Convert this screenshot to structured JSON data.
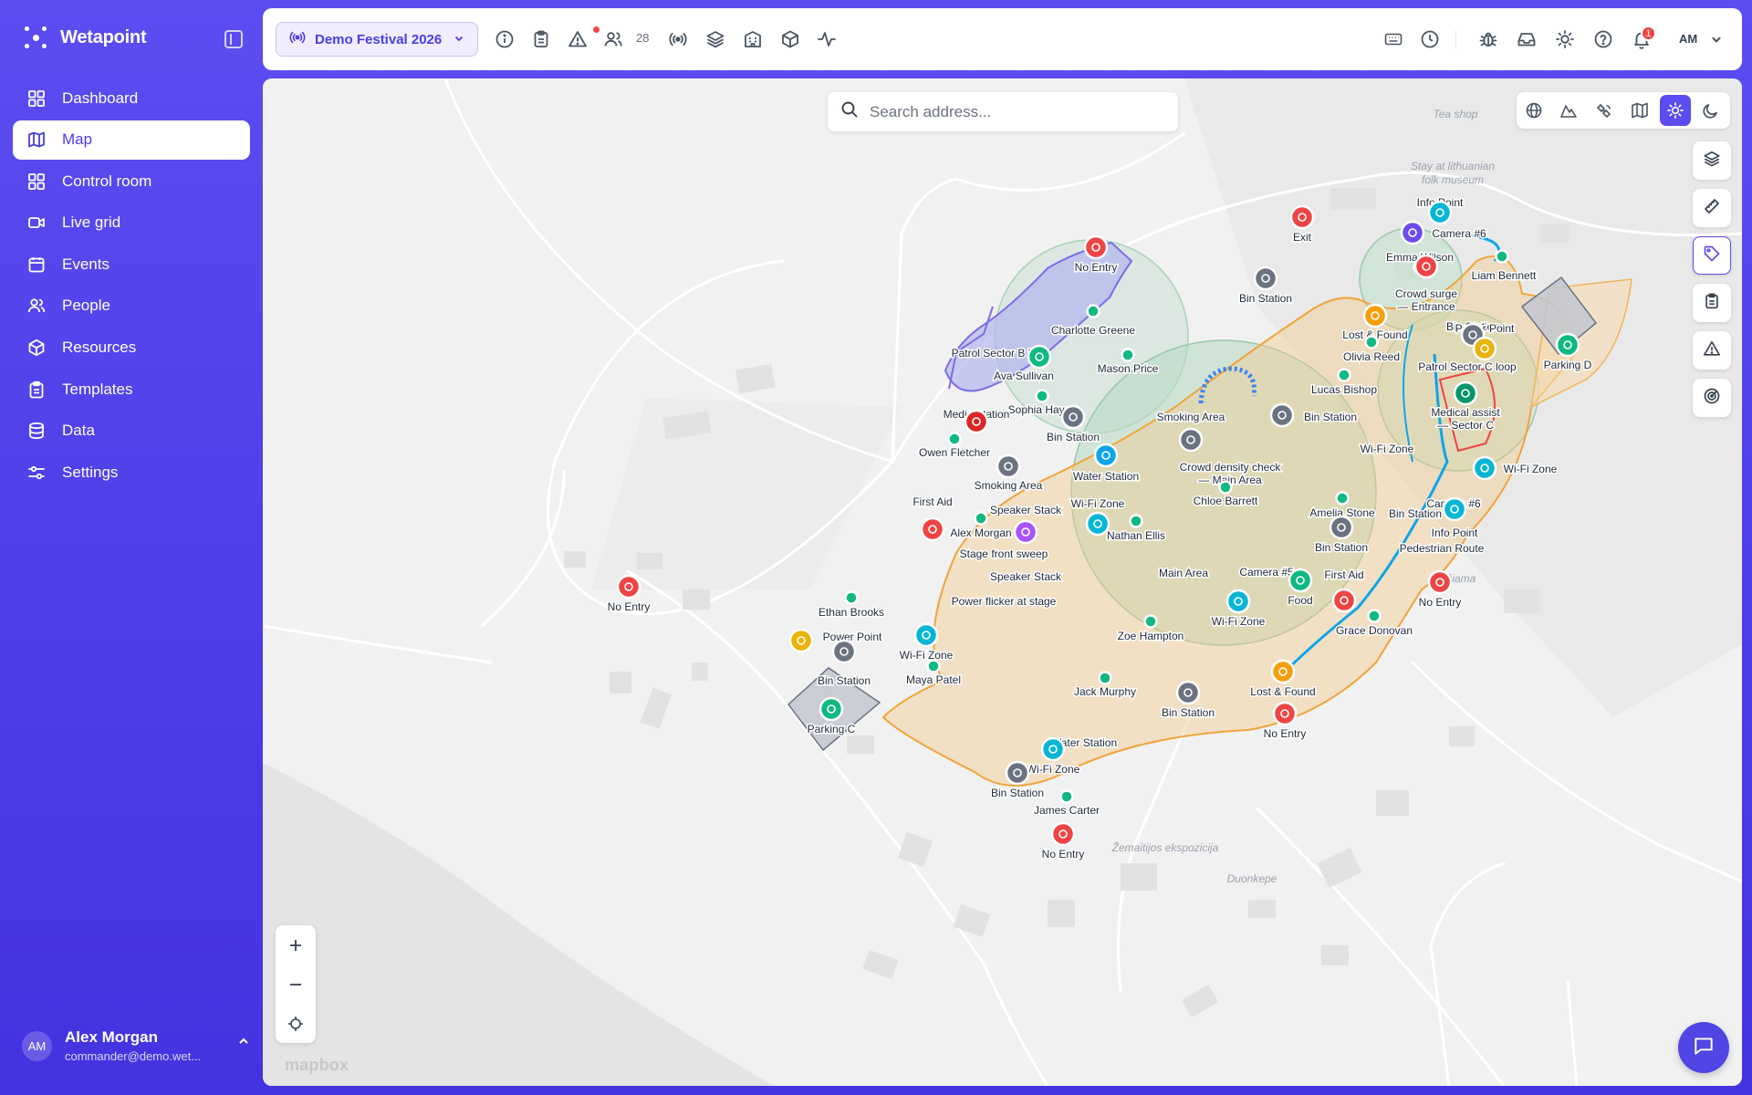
{
  "app": {
    "name": "Wetapoint"
  },
  "sidebar": {
    "items": [
      {
        "label": "Dashboard",
        "icon": "dashboard-icon"
      },
      {
        "label": "Map",
        "icon": "map-icon",
        "active": true
      },
      {
        "label": "Control room",
        "icon": "control-room-icon"
      },
      {
        "label": "Live grid",
        "icon": "video-icon"
      },
      {
        "label": "Events",
        "icon": "calendar-icon"
      },
      {
        "label": "People",
        "icon": "people-icon"
      },
      {
        "label": "Resources",
        "icon": "box-icon"
      },
      {
        "label": "Templates",
        "icon": "clipboard-icon"
      },
      {
        "label": "Data",
        "icon": "database-icon"
      },
      {
        "label": "Settings",
        "icon": "settings-icon"
      }
    ]
  },
  "user": {
    "initials": "AM",
    "name": "Alex Morgan",
    "email": "commander@demo.wet..."
  },
  "topbar": {
    "event_name": "Demo Festival 2026",
    "people_count": "28",
    "notification_count": "1",
    "user_initials": "AM"
  },
  "map": {
    "search_placeholder": "Search address...",
    "attribution": "mapbox",
    "place_labels": [
      {
        "text": "Tea shop"
      },
      {
        "text": "Stay at lithuanian"
      },
      {
        "text": "folk museum"
      },
      {
        "text": "Karčiama"
      },
      {
        "text": "Žemaitijos ekspozicija"
      },
      {
        "text": "Duonkepe"
      }
    ],
    "markers": [
      {
        "label": "No Entry",
        "type": "no-entry",
        "color": "#ef4444"
      },
      {
        "label": "Exit",
        "type": "exit",
        "color": "#ef4444"
      },
      {
        "label": "Info Point",
        "type": "info",
        "color": "#06b6d4"
      },
      {
        "label": "Camera #6",
        "type": "camera",
        "color": "#6d4be8"
      },
      {
        "label": "Emma Wilson",
        "type": "person",
        "color": "#10b981"
      },
      {
        "label": "Liam Bennett",
        "type": "person",
        "color": "#10b981"
      },
      {
        "label": "Crowd surge — Entrance",
        "type": "incident",
        "color": "#ef4444"
      },
      {
        "label": "Bin Station",
        "type": "bin",
        "color": "#6b7280"
      },
      {
        "label": "Charlotte Greene",
        "type": "person",
        "color": "#10b981"
      },
      {
        "label": "Power Point",
        "type": "power",
        "color": "#eab308"
      },
      {
        "label": "Parking D",
        "type": "parking",
        "color": "#10b981"
      },
      {
        "label": "Lost & Found",
        "type": "lost-found",
        "color": "#f59e0b"
      },
      {
        "label": "Olivia Reed",
        "type": "person",
        "color": "#10b981"
      },
      {
        "label": "Patrol Sector C loop",
        "type": "patrol",
        "color": "#eab308"
      },
      {
        "label": "Patrol Sector B loop",
        "type": "patrol",
        "color": "#10b981"
      },
      {
        "label": "Mason Price",
        "type": "person",
        "color": "#10b981"
      },
      {
        "label": "Ava Sullivan",
        "type": "person",
        "color": "#10b981"
      },
      {
        "label": "Lucas Bishop",
        "type": "person",
        "color": "#10b981"
      },
      {
        "label": "Medical assist — Sector C",
        "type": "medical",
        "color": "#059669"
      },
      {
        "label": "Sophia Hayes",
        "type": "person",
        "color": "#10b981"
      },
      {
        "label": "Medic Station",
        "type": "medic",
        "color": "#dc2626"
      },
      {
        "label": "Smoking Area",
        "type": "smoking",
        "color": "#6b7280"
      },
      {
        "label": "Owen Fletcher",
        "type": "person",
        "color": "#10b981"
      },
      {
        "label": "Crowd density check — Main Area",
        "type": "incident",
        "color": "#ef4444"
      },
      {
        "label": "Water Station",
        "type": "water",
        "color": "#0ea5e9"
      },
      {
        "label": "Wi-Fi Zone",
        "type": "wifi",
        "color": "#06b6d4"
      },
      {
        "label": "Chloe Barrett",
        "type": "person",
        "color": "#10b981"
      },
      {
        "label": "First Aid",
        "type": "first-aid",
        "color": "#ef4444"
      },
      {
        "label": "Speaker Stack",
        "type": "speaker",
        "color": "#a855f7"
      },
      {
        "label": "Alex Morgan",
        "type": "person",
        "color": "#10b981"
      },
      {
        "label": "Nathan Ellis",
        "type": "person",
        "color": "#10b981"
      },
      {
        "label": "Amelia Stone",
        "type": "person",
        "color": "#10b981"
      },
      {
        "label": "Pedestrian Route",
        "type": "route",
        "color": "#0ea5e9"
      },
      {
        "label": "Stage front sweep",
        "type": "patrol",
        "color": "#a855f7"
      },
      {
        "label": "Main Area",
        "type": "zone",
        "color": "#f59e0b"
      },
      {
        "label": "Camera #5",
        "type": "camera",
        "color": "#ec4899"
      },
      {
        "label": "Food",
        "type": "food",
        "color": "#10b981"
      },
      {
        "label": "Power flicker at stage",
        "type": "incident",
        "color": "#ef4444"
      },
      {
        "label": "Ethan Brooks",
        "type": "person",
        "color": "#10b981"
      },
      {
        "label": "Grace Donovan",
        "type": "person",
        "color": "#10b981"
      },
      {
        "label": "Zoe Hampton",
        "type": "person",
        "color": "#10b981"
      },
      {
        "label": "Maya Patel",
        "type": "person",
        "color": "#10b981"
      },
      {
        "label": "Jack Murphy",
        "type": "person",
        "color": "#10b981"
      },
      {
        "label": "Parking C",
        "type": "parking",
        "color": "#10b981"
      },
      {
        "label": "James Carter",
        "type": "person",
        "color": "#10b981"
      }
    ]
  }
}
